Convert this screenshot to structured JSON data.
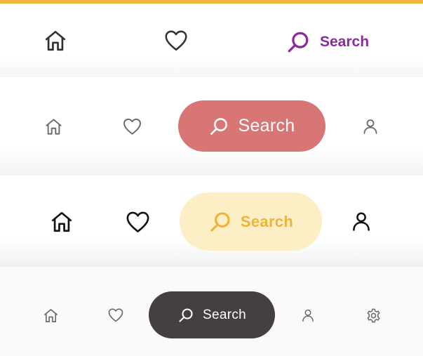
{
  "colors": {
    "top_accent": "#f0b53a",
    "row1_search": "#8b2a9e",
    "row2_pill": "#d87575",
    "row3_pill": "#fcefc5",
    "row3_text": "#efb337",
    "row4_pill": "#433f42"
  },
  "rows": [
    {
      "icons": [
        "home-icon",
        "heart-icon",
        "search-icon"
      ],
      "active_label": "Search"
    },
    {
      "icons": [
        "home-icon",
        "heart-icon",
        "search-icon",
        "user-icon"
      ],
      "active_label": "Search"
    },
    {
      "icons": [
        "home-icon",
        "heart-icon",
        "search-icon",
        "user-icon"
      ],
      "active_label": "Search"
    },
    {
      "icons": [
        "home-icon",
        "heart-icon",
        "search-icon",
        "user-icon",
        "gear-icon"
      ],
      "active_label": "Search"
    }
  ]
}
